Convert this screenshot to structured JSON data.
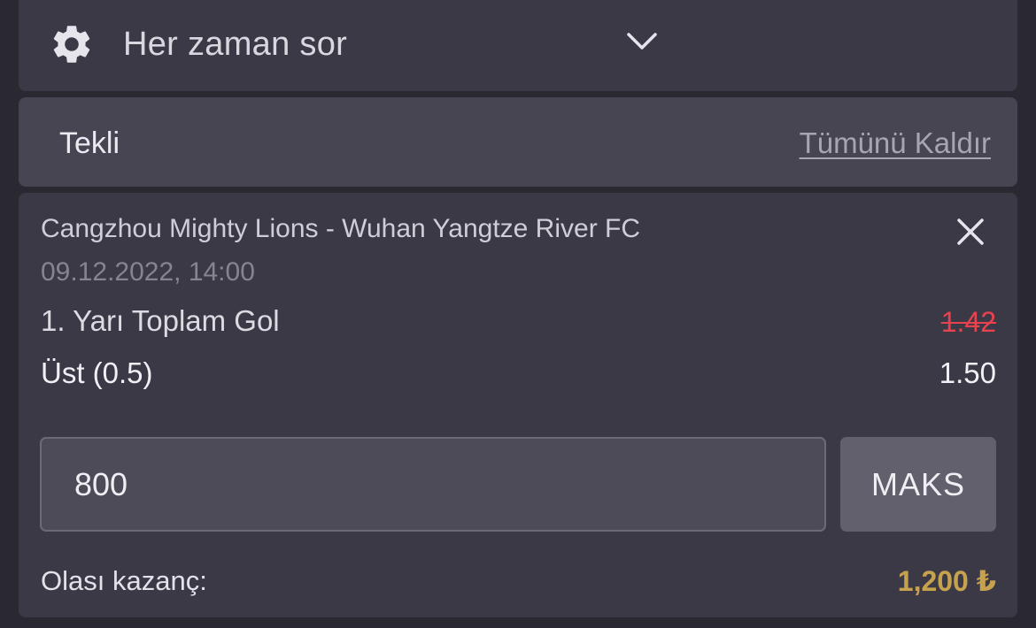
{
  "odds_change_setting": {
    "icon": "gear-icon",
    "label": "Her zaman sor",
    "chevron_icon": "chevron-down-icon"
  },
  "betslip": {
    "bet_type": "Tekli",
    "remove_all_label": "Tümünü Kaldır"
  },
  "selection": {
    "match": "Cangzhou Mighty Lions - Wuhan Yangtze River FC",
    "date": "09.12.2022, 14:00",
    "market": "1. Yarı Toplam Gol",
    "old_odds": "1.42",
    "outcome": "Üst (0.5)",
    "odds": "1.50",
    "close_icon": "close-icon"
  },
  "stake": {
    "value": "800",
    "max_label": "MAKS"
  },
  "potential_win": {
    "label": "Olası kazanç:",
    "amount": "1,200 ₺"
  },
  "colors": {
    "background": "#2a2831",
    "card": "#3b3946",
    "odds_decrease": "#e8424f",
    "win_amount": "#c6a24e"
  }
}
